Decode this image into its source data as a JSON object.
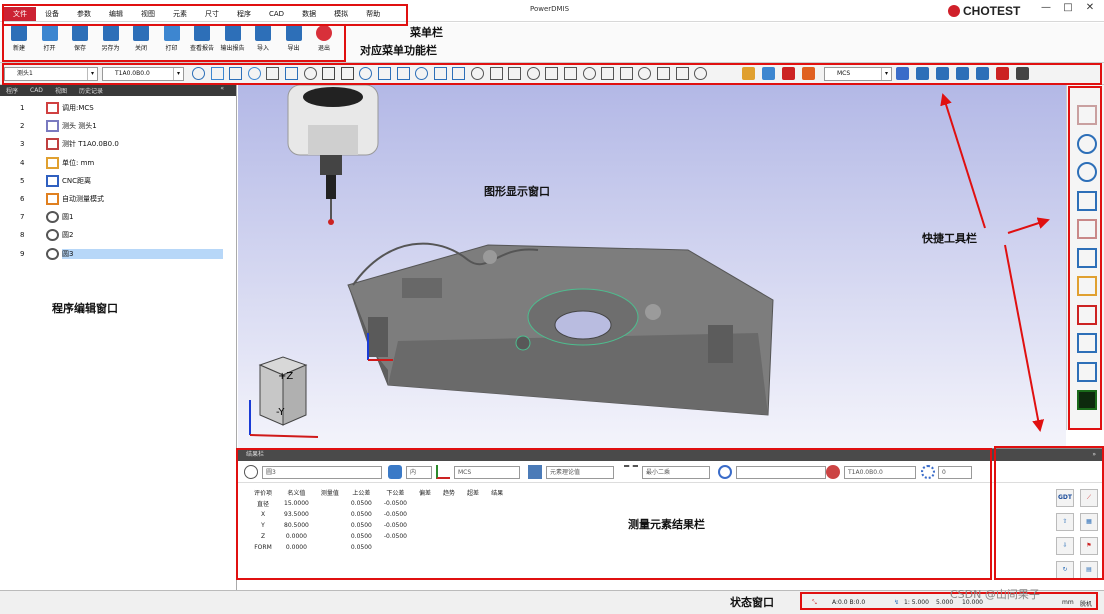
{
  "app_title": "PowerDMIS",
  "logo": "CHOTEST",
  "window_buttons": [
    "—",
    "□",
    "✕"
  ],
  "menu": [
    "文件",
    "设备",
    "参数",
    "编辑",
    "视图",
    "元素",
    "尺寸",
    "程序",
    "CAD",
    "数据",
    "模拟",
    "帮助"
  ],
  "ribbon": [
    {
      "label": "新建",
      "color": "#2d6fb8"
    },
    {
      "label": "打开",
      "color": "#3d86d0"
    },
    {
      "label": "保存",
      "color": "#2d6fb8"
    },
    {
      "label": "另存为",
      "color": "#2d6fb8"
    },
    {
      "label": "关闭",
      "color": "#2d6fb8"
    },
    {
      "label": "打印",
      "color": "#3d86d0"
    },
    {
      "label": "查看报告",
      "color": "#2d6fb8"
    },
    {
      "label": "输出报告",
      "color": "#2d6fb8"
    },
    {
      "label": "导入",
      "color": "#2d6fb8"
    },
    {
      "label": "导出",
      "color": "#2d6fb8"
    },
    {
      "label": "退出",
      "color": "#d8303a"
    }
  ],
  "toolbar": {
    "probe": "测头1",
    "tip": "T1A0.0B0.0",
    "coord_system": "MCS"
  },
  "left_panel": {
    "tabs": [
      "程序",
      "CAD",
      "视图",
      "历史记录"
    ],
    "collapse": "«",
    "program": [
      {
        "num": "1",
        "label": "调用:MCS",
        "color": "#d04040"
      },
      {
        "num": "2",
        "label": "测头 测头1",
        "color": "#7a7ac0"
      },
      {
        "num": "3",
        "label": "测针 T1A0.0B0.0",
        "color": "#c04040"
      },
      {
        "num": "4",
        "label": "单位: mm",
        "color": "#e0a030"
      },
      {
        "num": "5",
        "label": "CNC距离",
        "color": "#3060c0"
      },
      {
        "num": "6",
        "label": "自动测量模式",
        "color": "#e08020"
      },
      {
        "num": "7",
        "label": "圆1",
        "color": "#555555"
      },
      {
        "num": "8",
        "label": "圆2",
        "color": "#555555"
      },
      {
        "num": "9",
        "label": "圆3",
        "color": "#555555"
      }
    ]
  },
  "viewcube": {
    "top": "+Z",
    "front": "-Y"
  },
  "results": {
    "title": "结果栏",
    "collapse": "»",
    "feature": "圆3",
    "mode": "内",
    "coord": "MCS",
    "theory": "元素理论值",
    "fit": "最小二乘",
    "tip": "T1A0.0B0.0",
    "count": "0",
    "headers": [
      "评价项",
      "名义值",
      "测量值",
      "上公差",
      "下公差",
      "偏差",
      "趋势",
      "超差",
      "结果"
    ],
    "rows": [
      [
        "直径",
        "15.0000",
        "",
        "0.0500",
        "-0.0500",
        "",
        "",
        "",
        ""
      ],
      [
        "X",
        "93.5000",
        "",
        "0.0500",
        "-0.0500",
        "",
        "",
        "",
        ""
      ],
      [
        "Y",
        "80.5000",
        "",
        "0.0500",
        "-0.0500",
        "",
        "",
        "",
        ""
      ],
      [
        "Z",
        "0.0000",
        "",
        "0.0500",
        "-0.0500",
        "",
        "",
        "",
        ""
      ],
      [
        "FORM",
        "0.0000",
        "",
        "0.0500",
        "",
        "",
        "",
        "",
        ""
      ]
    ],
    "side_gdt": "GDT"
  },
  "status": {
    "ab": "A:0.0  B:0.0",
    "vals": [
      "1: 5.000",
      "5.000",
      "10.000"
    ],
    "unit": "mm",
    "mode": "脱机"
  },
  "annotations": {
    "menubar": "菜单栏",
    "ribbon": "对应菜单功能栏",
    "viewport": "图形显示窗口",
    "quicktools": "快捷工具栏",
    "program": "程序编辑窗口",
    "results": "测量元素结果栏",
    "status": "状态窗口"
  },
  "watermark": "CSDN @山间果子",
  "colors": {
    "accent": "#cc2233",
    "annotation": "#e01010",
    "selection": "#b7d7f8"
  }
}
